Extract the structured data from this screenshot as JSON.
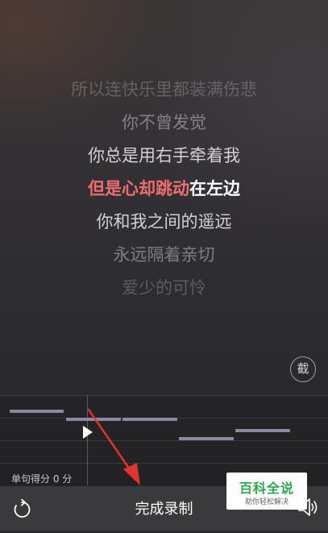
{
  "lyrics": {
    "lines": [
      "所以连快乐里都装满伤悲",
      "你不曾发觉",
      "你总是用右手牵着我",
      "你和我之间的遥远",
      "永远隔着亲切",
      "爱少的可怜"
    ],
    "current_sung": "但是心却跳动",
    "current_rest": "在左边"
  },
  "crop_button_label": "截",
  "pitch_panel": {
    "score_text": "单句得分 0 分"
  },
  "bottom_bar": {
    "finish_label": "完成录制",
    "restart_icon": "restart-icon",
    "speaker_icon": "speaker-icon"
  },
  "watermark": {
    "title": "百科全说",
    "subtitle": "助你轻松解决"
  },
  "colors": {
    "sung_highlight": "#ee6e6e",
    "pitch_note": "#8a8aa2",
    "annotation_arrow": "#e0342f",
    "watermark_green": "#2aa84a"
  }
}
